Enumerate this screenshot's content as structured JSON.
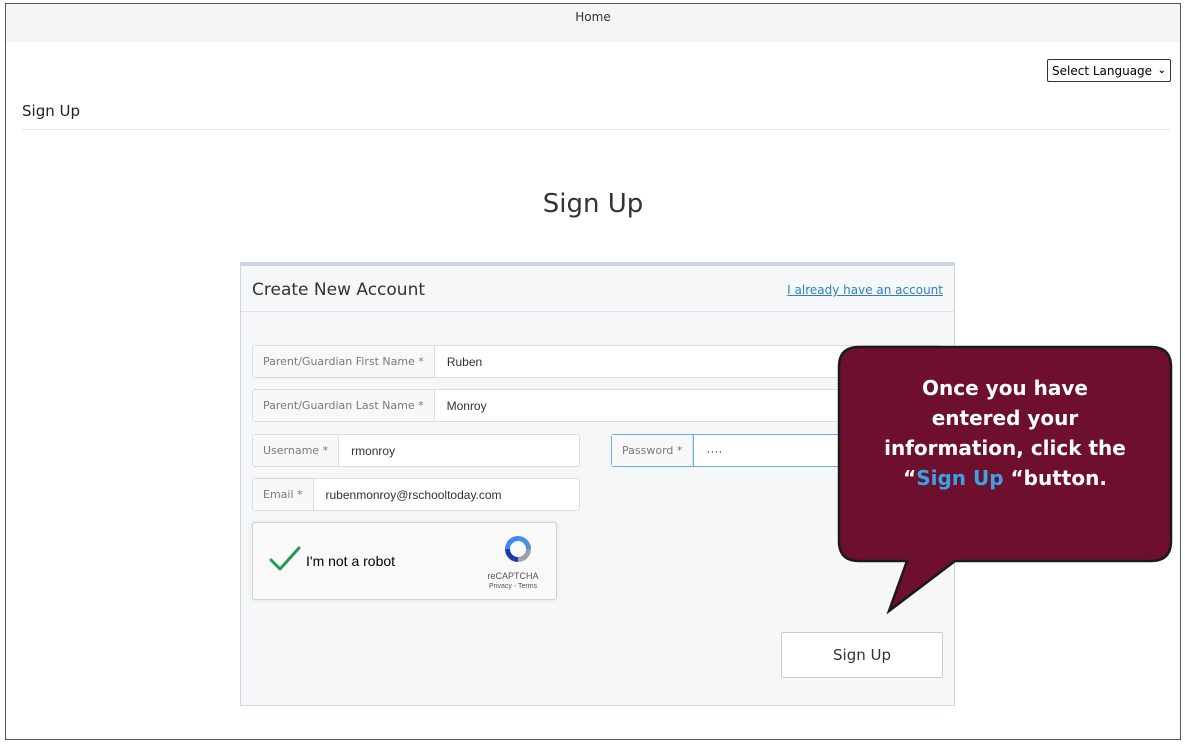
{
  "topbar": {
    "home_label": "Home"
  },
  "language": {
    "selected": "Select Language"
  },
  "breadcrumb": {
    "title": "Sign Up"
  },
  "page": {
    "title": "Sign Up"
  },
  "panel": {
    "title": "Create New Account",
    "login_link": "I already have an account"
  },
  "form": {
    "first_name": {
      "label": "Parent/Guardian First Name *",
      "value": "Ruben"
    },
    "last_name": {
      "label": "Parent/Guardian Last Name *",
      "value": "Monroy"
    },
    "username": {
      "label": "Username *",
      "value": "rmonroy"
    },
    "password": {
      "label": "Password *",
      "value": "····"
    },
    "email": {
      "label": "Email *",
      "value": "rubenmonroy@rschooltoday.com"
    }
  },
  "captcha": {
    "label": "I'm not a robot",
    "brand": "reCAPTCHA",
    "terms": "Privacy - Terms"
  },
  "signup_button": {
    "label": "Sign Up"
  },
  "callout": {
    "line1": "Once you have",
    "line2": "entered your",
    "line3": "information, click the",
    "quote_open": "“",
    "highlight": "Sign Up",
    "line4_rest": " “button."
  },
  "colors": {
    "callout_fill": "#6e0f2e",
    "callout_highlight": "#3aa3e3",
    "link": "#2f7fc1",
    "check": "#1e9d4e"
  }
}
